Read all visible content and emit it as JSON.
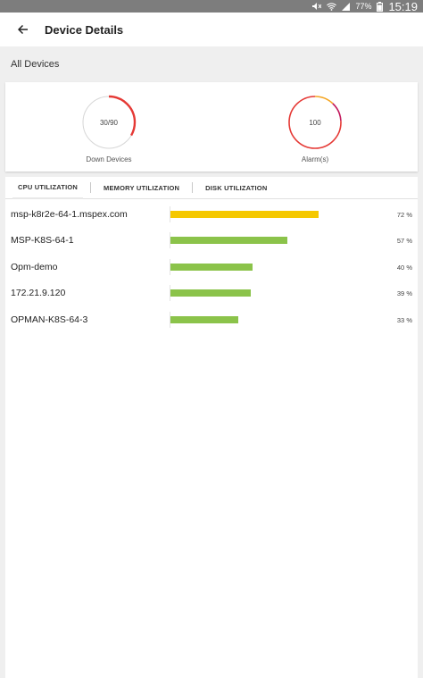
{
  "status_bar": {
    "battery": "77%",
    "time": "15:19",
    "icons": [
      "mute-icon",
      "wifi-icon",
      "signal-icon",
      "battery-icon"
    ]
  },
  "app_bar": {
    "title": "Device Details",
    "back_icon": "arrow-left-icon"
  },
  "section": {
    "header": "All Devices"
  },
  "summary": {
    "down_devices": {
      "value": "30/90",
      "label": "Down Devices",
      "fraction": 0.3333,
      "color": "#e53935"
    },
    "alarms": {
      "value": "100",
      "label": "Alarm(s)",
      "segments": [
        {
          "color": "#f5a623",
          "fraction": 0.12
        },
        {
          "color": "#c2185b",
          "fraction": 0.12
        },
        {
          "color": "#e53935",
          "fraction": 0.76
        }
      ]
    }
  },
  "tabs": [
    {
      "label": "CPU UTILIZATION",
      "active": true
    },
    {
      "label": "MEMORY UTILIZATION",
      "active": false
    },
    {
      "label": "DISK UTILIZATION",
      "active": false
    }
  ],
  "devices": [
    {
      "name": "msp-k8r2e-64-1.mspex.com",
      "percent": 72,
      "percent_label": "72 %",
      "color": "#f5c800"
    },
    {
      "name": "MSP-K8S-64-1",
      "percent": 57,
      "percent_label": "57 %",
      "color": "#8bc34a"
    },
    {
      "name": "Opm-demo",
      "percent": 40,
      "percent_label": "40 %",
      "color": "#8bc34a"
    },
    {
      "name": "172.21.9.120",
      "percent": 39,
      "percent_label": "39 %",
      "color": "#8bc34a"
    },
    {
      "name": "OPMAN-K8S-64-3",
      "percent": 33,
      "percent_label": "33 %",
      "color": "#8bc34a"
    }
  ]
}
